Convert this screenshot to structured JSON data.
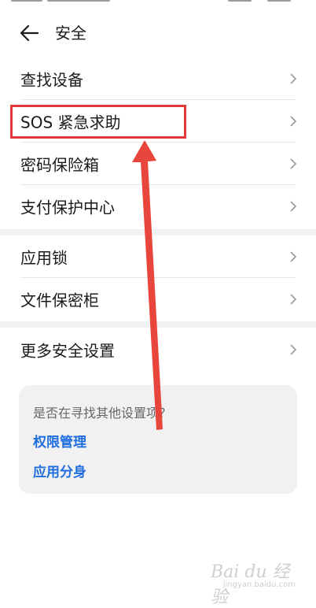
{
  "header": {
    "title": "安全"
  },
  "group1": [
    {
      "label": "查找设备"
    },
    {
      "label": "SOS 紧急求助"
    },
    {
      "label": "密码保险箱"
    },
    {
      "label": "支付保护中心"
    }
  ],
  "group2": [
    {
      "label": "应用锁"
    },
    {
      "label": "文件保密柜"
    }
  ],
  "group3": [
    {
      "label": "更多安全设置"
    }
  ],
  "card": {
    "question": "是否在寻找其他设置项？",
    "links": [
      "权限管理",
      "应用分身"
    ]
  },
  "watermark": {
    "text": "Bai du 经验",
    "sub": "jingyan.baidu.com"
  },
  "colors": {
    "accent": "#1f6ee0",
    "annotation": "#e03a3a"
  }
}
